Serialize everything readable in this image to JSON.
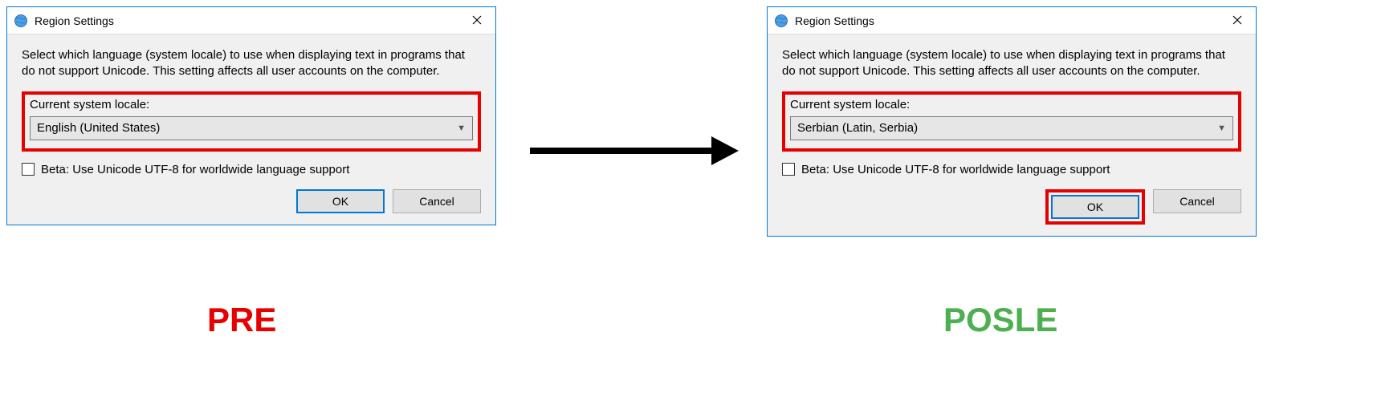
{
  "left": {
    "title": "Region Settings",
    "description": "Select which language (system locale) to use when displaying text in programs that do not support Unicode. This setting affects all user accounts on the computer.",
    "locale_label": "Current system locale:",
    "locale_value": "English (United States)",
    "checkbox_label": "Beta: Use Unicode UTF-8 for worldwide language support",
    "ok_label": "OK",
    "cancel_label": "Cancel",
    "caption": "PRE"
  },
  "right": {
    "title": "Region Settings",
    "description": "Select which language (system locale) to use when displaying text in programs that do not support Unicode. This setting affects all user accounts on the computer.",
    "locale_label": "Current system locale:",
    "locale_value": "Serbian (Latin, Serbia)",
    "checkbox_label": "Beta: Use Unicode UTF-8 for worldwide language support",
    "ok_label": "OK",
    "cancel_label": "Cancel",
    "caption": "POSLE"
  }
}
